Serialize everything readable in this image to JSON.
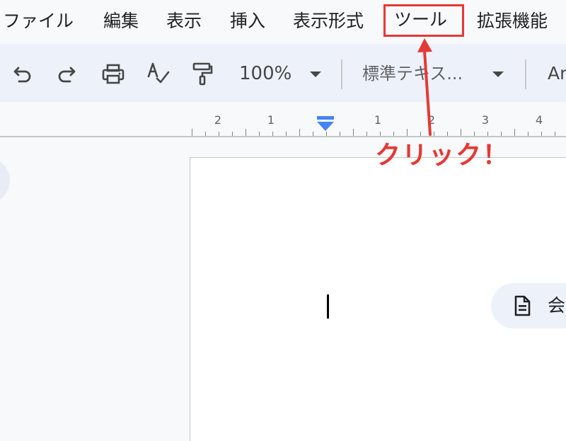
{
  "menu": {
    "items": [
      {
        "label": "ファイル",
        "id": "file"
      },
      {
        "label": "編集",
        "id": "edit"
      },
      {
        "label": "表示",
        "id": "view"
      },
      {
        "label": "挿入",
        "id": "insert"
      },
      {
        "label": "表示形式",
        "id": "format"
      },
      {
        "label": "ツール",
        "id": "tools",
        "highlighted": true
      },
      {
        "label": "拡張機能",
        "id": "extensions"
      }
    ]
  },
  "toolbar": {
    "icons": [
      "undo-icon",
      "redo-icon",
      "print-icon",
      "spellcheck-icon",
      "paint-format-icon"
    ],
    "zoom": "100%",
    "paragraph_style": "標準テキス...",
    "font": "Ari"
  },
  "ruler": {
    "labels": [
      "2",
      "1",
      "1",
      "2",
      "3",
      "4"
    ],
    "indent_marker_color": "#4285f4"
  },
  "document": {
    "chip_label": "会議"
  },
  "annotation": {
    "text": "クリック！",
    "color": "#e53935"
  }
}
